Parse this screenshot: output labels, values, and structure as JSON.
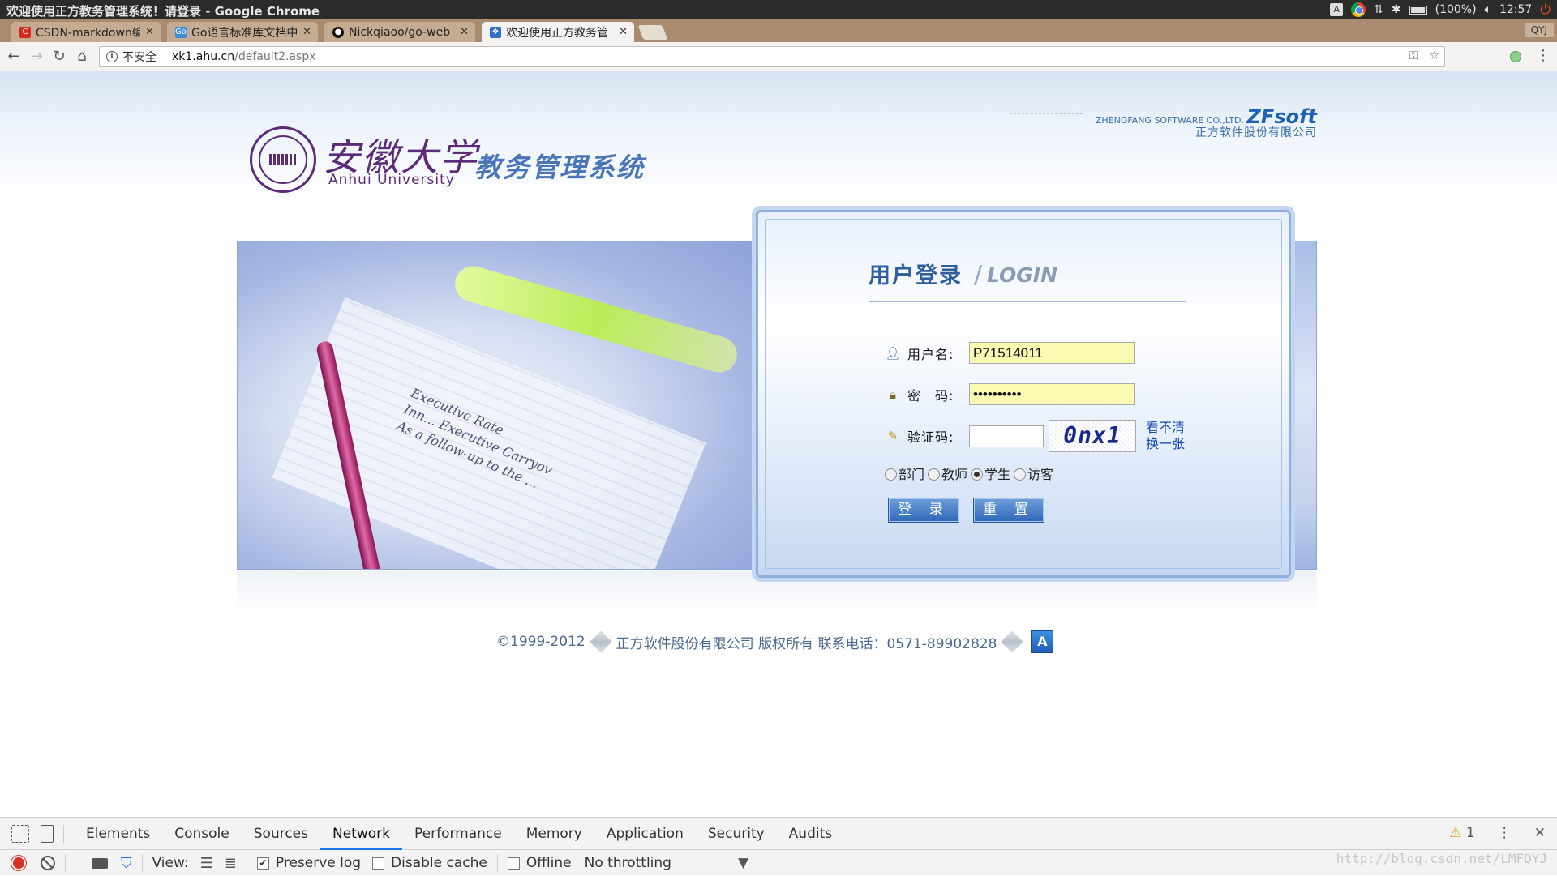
{
  "window": {
    "title": "欢迎使用正方教务管理系统！请登录 - Google Chrome",
    "tray": {
      "battery": "(100%)",
      "clock": "12:57",
      "kb": "A"
    }
  },
  "tabs": [
    {
      "label": "CSDN-markdown编",
      "icon": "csdn-icon",
      "color": "#d52b1e"
    },
    {
      "label": "Go语言标准库文档中",
      "icon": "go-icon",
      "color": "#3a8dd6"
    },
    {
      "label": "Nickqiaoo/go-web",
      "icon": "github-icon",
      "color": "#111111"
    },
    {
      "label": "欢迎使用正方教务管",
      "icon": "zf-icon",
      "color": "#3070c8"
    }
  ],
  "profile": "QYJ",
  "address": {
    "security": "不安全",
    "host": "xk1.ahu.cn",
    "path": "/default2.aspx"
  },
  "page": {
    "university_cn": "安徽大学",
    "university_en": "Anhui University",
    "system_name": "教务管理系统",
    "vendor_en": "ZHENGFANG SOFTWARE CO.,LTD.",
    "vendor_brand": "ZFsoft",
    "vendor_cn": "正方软件股份有限公司",
    "banner_text": [
      "Executive Rate",
      "Inn... Executive Carryov",
      "As a follow-up to the ..."
    ],
    "login": {
      "title_cn": "用户登录",
      "separator": "/",
      "title_en": "LOGIN",
      "username_label": "用户名:",
      "username_value": "P71514011",
      "password_label": "密　码:",
      "password_value": "••••••••••",
      "captcha_label": "验证码:",
      "captcha_value": "",
      "captcha_image": "0nx1",
      "captcha_link_1": "看不清",
      "captcha_link_2": "换一张",
      "roles": [
        {
          "label": "部门",
          "checked": false
        },
        {
          "label": "教师",
          "checked": false
        },
        {
          "label": "学生",
          "checked": true
        },
        {
          "label": "访客",
          "checked": false
        }
      ],
      "login_button": "登 录",
      "reset_button": "重 置"
    },
    "footer": {
      "copyright": "©1999-2012",
      "company": "正方软件股份有限公司 版权所有  联系电话：0571-89902828",
      "icon_letter": "A"
    }
  },
  "devtools": {
    "tabs": [
      "Elements",
      "Console",
      "Sources",
      "Network",
      "Performance",
      "Memory",
      "Application",
      "Security",
      "Audits"
    ],
    "active_tab": "Network",
    "warning_count": "1",
    "network": {
      "view_label": "View:",
      "preserve_log": "Preserve log",
      "preserve_log_checked": true,
      "disable_cache": "Disable cache",
      "offline": "Offline",
      "throttling": "No throttling"
    }
  },
  "watermark": "http://blog.csdn.net/LMFQYJ"
}
